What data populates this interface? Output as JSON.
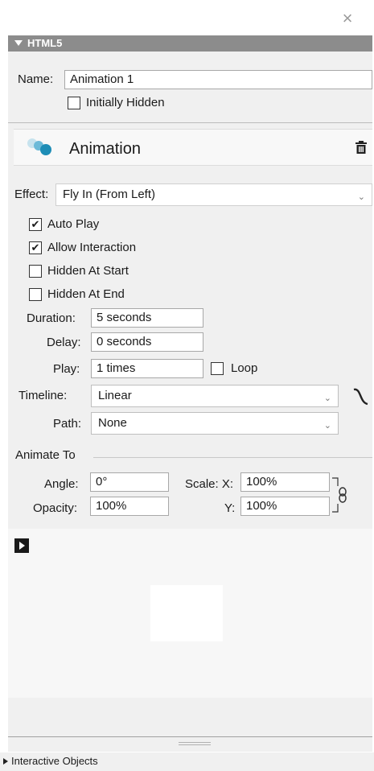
{
  "panel": {
    "title": "HTML5",
    "close_icon": "close-icon"
  },
  "name": {
    "label": "Name:",
    "value": "Animation 1"
  },
  "initially_hidden": {
    "label": "Initially Hidden",
    "checked": false
  },
  "animation": {
    "title": "Animation",
    "icon": "animation-dots-icon",
    "trash_icon": "trash-icon"
  },
  "effect": {
    "label": "Effect:",
    "value": "Fly In (From Left)"
  },
  "checkboxes": [
    {
      "label": "Auto Play",
      "checked": true
    },
    {
      "label": "Allow Interaction",
      "checked": true
    },
    {
      "label": "Hidden At Start",
      "checked": false
    },
    {
      "label": "Hidden At End",
      "checked": false
    }
  ],
  "duration": {
    "label": "Duration:",
    "value": "5 seconds"
  },
  "delay": {
    "label": "Delay:",
    "value": "0 seconds"
  },
  "play": {
    "label": "Play:",
    "value": "1 times"
  },
  "loop": {
    "label": "Loop",
    "checked": false
  },
  "timeline": {
    "label": "Timeline:",
    "value": "Linear"
  },
  "path": {
    "label": "Path:",
    "value": "None"
  },
  "animate_to": {
    "heading": "Animate To",
    "angle_label": "Angle:",
    "angle_value": "0°",
    "opacity_label": "Opacity:",
    "opacity_value": "100%",
    "scale_x_label": "Scale: X:",
    "scale_x_value": "100%",
    "scale_y_label": "Y:",
    "scale_y_value": "100%"
  },
  "footer": {
    "interactive_objects": "Interactive Objects"
  },
  "colors": {
    "header_bg": "#8c8c8c",
    "panel_bg": "#f0f0f0",
    "accent_teal": "#2a8fb0"
  }
}
